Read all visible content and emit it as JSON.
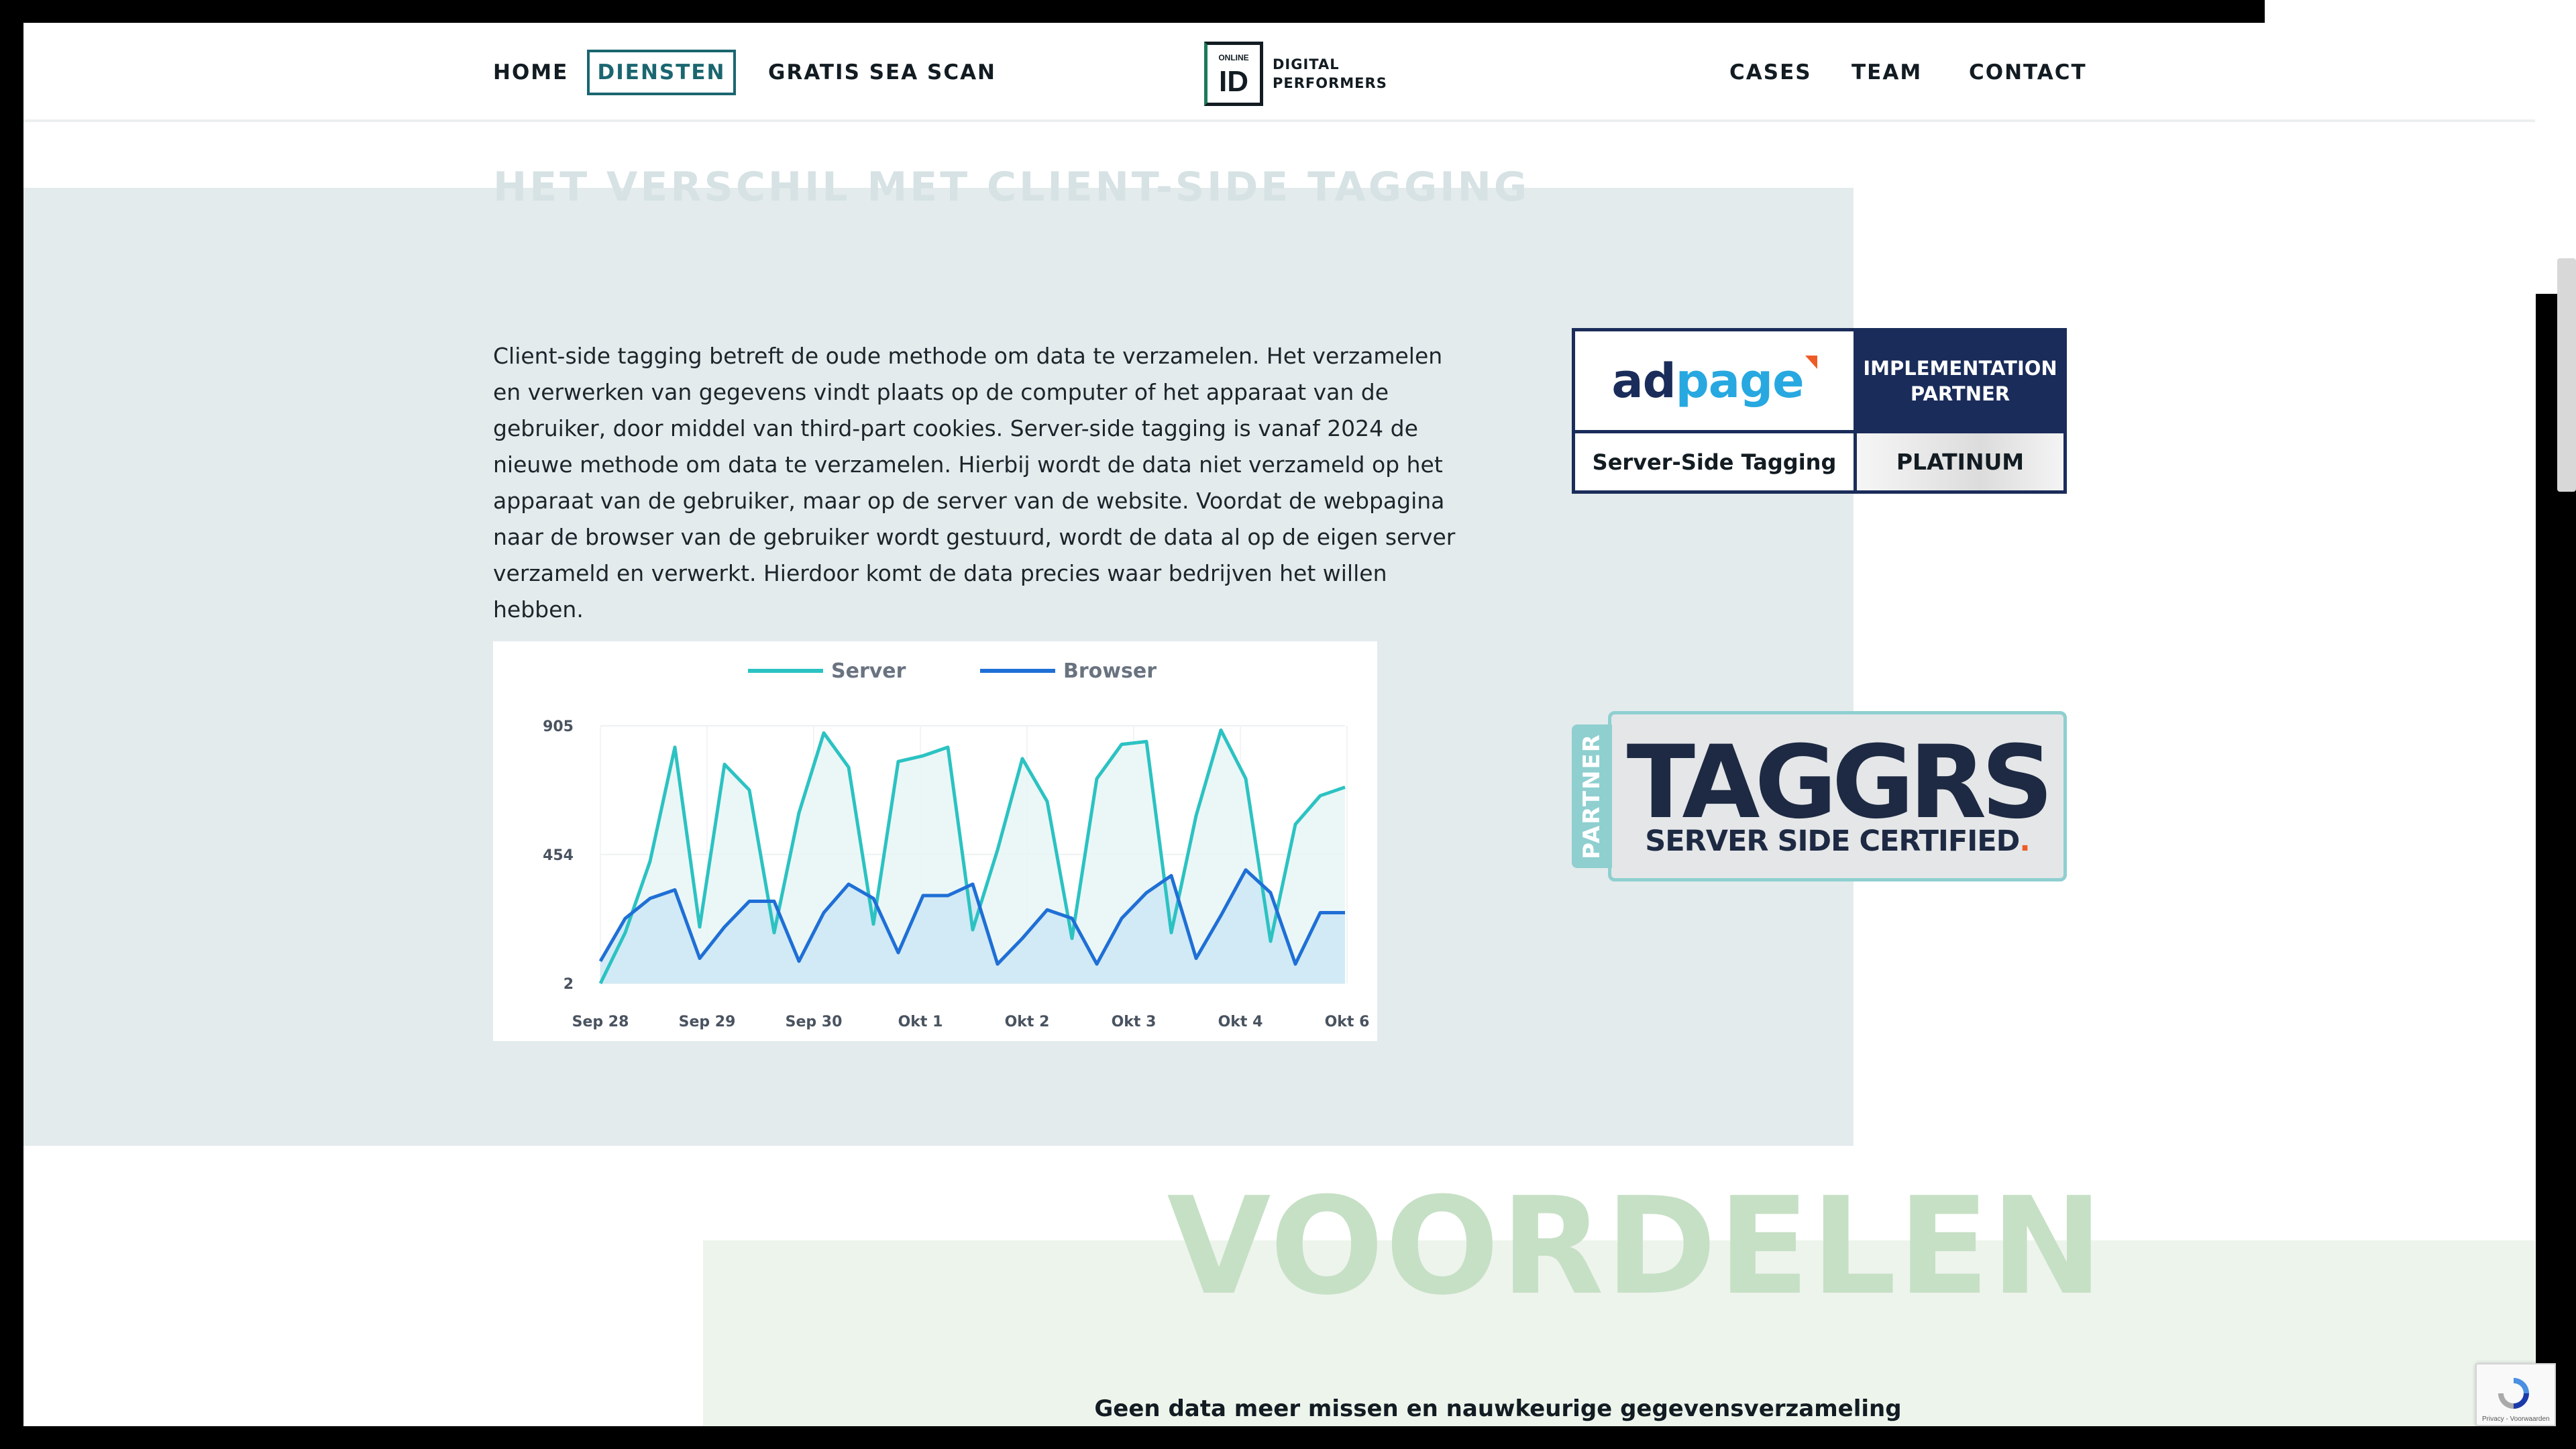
{
  "nav": {
    "home": "HOME",
    "diensten": "DIENSTEN",
    "gratis_sea_scan": "GRATIS SEA SCAN",
    "cases": "CASES",
    "team": "TEAM",
    "contact": "CONTACT"
  },
  "logo": {
    "small": "ONLINE",
    "id": "ID",
    "line1": "DIGITAL",
    "line2": "PERFORMERS"
  },
  "section1": {
    "title": "HET VERSCHIL MET CLIENT-SIDE TAGGING",
    "body": "Client-side tagging betreft de oude methode om data te verzamelen. Het verzamelen en verwerken van gegevens vindt plaats op de computer of het apparaat van de gebruiker, door middel van third-part cookies. Server-side tagging is vanaf 2024 de nieuwe methode om data te verzamelen. Hierbij wordt de data niet verzameld op het apparaat van de gebruiker, maar op de server van de website. Voordat de webpagina naar de browser van de gebruiker wordt gestuurd, wordt de data al op de eigen server verzameld en verwerkt. Hierdoor komt de data precies waar bedrijven het willen hebben."
  },
  "chart_data": {
    "type": "area",
    "title": "",
    "xlabel": "",
    "ylabel": "",
    "legend_placement": "top-center",
    "grid": true,
    "x_tick_labels": [
      "Sep 28",
      "Sep 29",
      "Sep 30",
      "Okt 1",
      "Okt 2",
      "Okt 3",
      "Okt 4",
      "Okt 6"
    ],
    "y_tick_labels": [
      "905",
      "454",
      "2"
    ],
    "ylim": [
      2,
      905
    ],
    "x": [
      0,
      0.25,
      0.5,
      0.75,
      1,
      1.25,
      1.5,
      1.75,
      2,
      2.25,
      2.5,
      2.75,
      3,
      3.25,
      3.5,
      3.75,
      4,
      4.25,
      4.5,
      4.75,
      5,
      5.25,
      5.5,
      5.75,
      6,
      6.25,
      6.5,
      6.75,
      7,
      7.25,
      7.5
    ],
    "series": [
      {
        "name": "Server",
        "color": "#2cc2c2",
        "fill": "#e8f6f5",
        "values": [
          2,
          180,
          430,
          830,
          200,
          770,
          680,
          180,
          600,
          880,
          760,
          210,
          780,
          800,
          830,
          190,
          470,
          790,
          640,
          160,
          720,
          840,
          850,
          180,
          590,
          890,
          720,
          150,
          560,
          660,
          690
        ]
      },
      {
        "name": "Browser",
        "color": "#1f6fd6",
        "fill": "#cce8f4",
        "values": [
          80,
          230,
          300,
          330,
          90,
          200,
          290,
          290,
          80,
          250,
          350,
          300,
          110,
          310,
          310,
          350,
          70,
          160,
          260,
          230,
          70,
          230,
          320,
          380,
          90,
          240,
          400,
          320,
          70,
          250,
          250
        ]
      }
    ]
  },
  "adpage_badge": {
    "logo_ad": "ad",
    "logo_page": "page",
    "partner": "IMPLEMENTATION PARTNER",
    "service": "Server-Side Tagging",
    "tier": "PLATINUM",
    "brand_orange": "#ef5b26",
    "brand_blue": "#27a8e0",
    "brand_navy": "#1a2c5a"
  },
  "taggrs_badge": {
    "partner": "PARTNER",
    "word": "TAGGRS",
    "sub": "SERVER SIDE CERTIFIED",
    "dot": "."
  },
  "section2": {
    "title": "VOORDELEN",
    "subtitle": "Geen data meer missen en nauwkeurige gegevensverzameling"
  },
  "recaptcha": {
    "text": "Privacy - Voorwaarden"
  }
}
